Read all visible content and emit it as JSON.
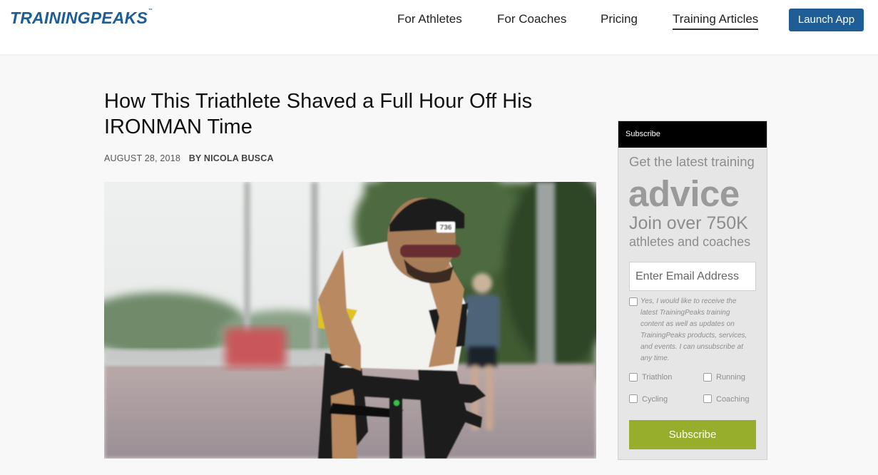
{
  "brand": {
    "logo_text": "TRAININGPEAKS",
    "logo_tm": "™"
  },
  "nav": {
    "items": [
      {
        "label": "For Athletes"
      },
      {
        "label": "For Coaches"
      },
      {
        "label": "Pricing"
      },
      {
        "label": "Training Articles",
        "active": true
      }
    ],
    "launch_label": "Launch App"
  },
  "article": {
    "title": "How This Triathlete Shaved a Full Hour Off His IRONMAN Time",
    "date": "AUGUST 28, 2018",
    "byline": "BY NICOLA BUSCA",
    "hero": {
      "bib_number": "736"
    }
  },
  "subscribe": {
    "header": "Subscribe",
    "line1": "Get the latest training",
    "line2": "advice",
    "line3": "Join over 750K",
    "line4": "athletes and coaches",
    "email_placeholder": "Enter Email Address",
    "consent": "Yes, I would like to receive the latest TrainingPeaks training content as well as updates on TrainingPeaks products, services, and events. I can unsubscribe at any time.",
    "options": [
      "Triathlon",
      "Running",
      "Cycling",
      "Coaching"
    ],
    "button_label": "Subscribe"
  },
  "colors": {
    "brand_blue": "#1e5d95",
    "subscribe_green": "#97ad2c"
  }
}
